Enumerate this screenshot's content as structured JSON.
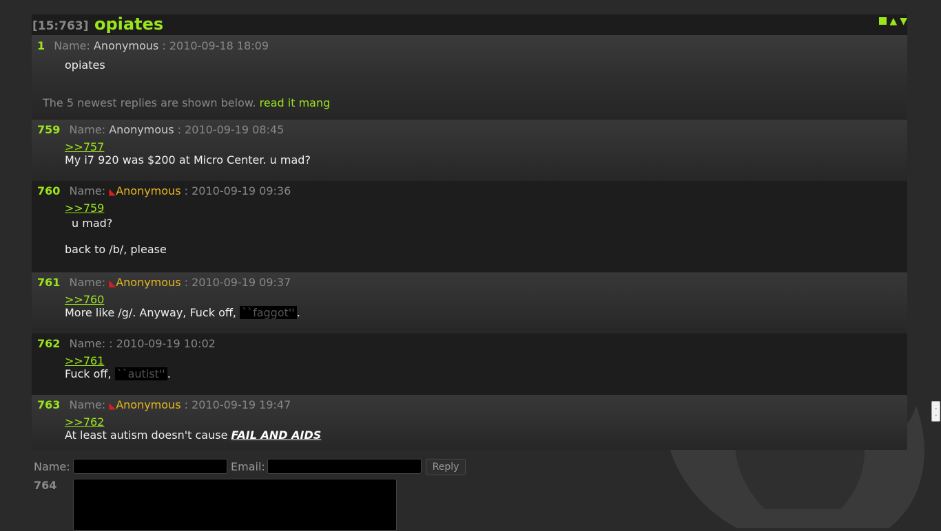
{
  "thread": {
    "id": "[15:763]",
    "title": "opiates",
    "controls": [
      "square",
      "▲",
      "▼"
    ]
  },
  "op": {
    "num": "1",
    "name_label": "Name:",
    "name": "Anonymous",
    "date": ": 2010-09-18 18:09",
    "body": "opiates"
  },
  "notice": {
    "text": "The 5 newest replies are shown below.",
    "link": "read it mang"
  },
  "posts": [
    {
      "num": "759",
      "name_label": "Name:",
      "name": "Anonymous",
      "date": ": 2010-09-19 08:45",
      "quote": ">>757",
      "line1": "My i7 920 was $200 at Micro Center. u mad?"
    },
    {
      "num": "760",
      "name_label": "Name:",
      "name": "Anonymous",
      "trip": "◣",
      "date": ": 2010-09-19 09:36",
      "quote": ">>759",
      "line1": "u mad?",
      "line2": "back to /b/, please"
    },
    {
      "num": "761",
      "name_label": "Name:",
      "name": "Anonymous",
      "trip": "◣",
      "date": ": 2010-09-19 09:37",
      "quote": ">>760",
      "line1": "More like /g/. Anyway, Fuck off,",
      "spoiler": "``faggot''",
      "end": "."
    },
    {
      "num": "762",
      "name_label": "Name:",
      "date": ": 2010-09-19 10:02",
      "quote": ">>761",
      "line1": "Fuck off,",
      "spoiler": "``autist''",
      "end": "."
    },
    {
      "num": "763",
      "name_label": "Name:",
      "name": "Anonymous",
      "trip": "◣",
      "date": ": 2010-09-19 19:47",
      "quote": ">>762",
      "line1": "At least autism doesn't cause",
      "emph": "FAIL AND AIDS"
    }
  ],
  "reply_form": {
    "name_label": "Name:",
    "email_label": "Email:",
    "reply_button": "Reply",
    "next_num": "764"
  },
  "colors": {
    "accent": "#9be51b",
    "tripname": "#e8b81c",
    "tripmark": "#d31f1f"
  }
}
